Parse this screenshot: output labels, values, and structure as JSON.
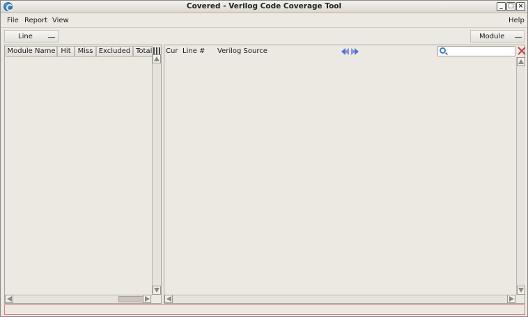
{
  "window": {
    "title": "Covered - Verilog Code Coverage Tool"
  },
  "titlebar_buttons": {
    "minimize": "_",
    "maximize": "□",
    "close": "×"
  },
  "menu": {
    "file": "File",
    "report": "Report",
    "view": "View",
    "help": "Help"
  },
  "toolbar": {
    "coverage_type": "Line",
    "scope": "Module"
  },
  "module_table": {
    "columns": [
      "Module Name",
      "Hit",
      "Miss",
      "Excluded",
      "Total"
    ],
    "rows": []
  },
  "source_view": {
    "columns": [
      "Cur",
      "Line #",
      "Verilog Source"
    ],
    "search": {
      "value": "",
      "placeholder": ""
    }
  },
  "status": {
    "text": ""
  },
  "colors": {
    "nav_arrow": "#4a6fd8",
    "clear": "#d13b3b",
    "search": "#3a7bd5",
    "status_border": "#d98080"
  }
}
